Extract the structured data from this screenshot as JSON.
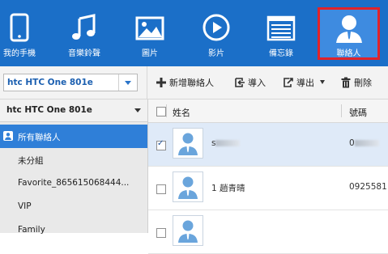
{
  "nav": {
    "items": [
      {
        "label": "我的手機",
        "icon": "phone-icon"
      },
      {
        "label": "音樂鈴聲",
        "icon": "music-note-icon"
      },
      {
        "label": "圖片",
        "icon": "picture-icon"
      },
      {
        "label": "影片",
        "icon": "video-play-icon"
      },
      {
        "label": "備忘錄",
        "icon": "memo-icon"
      },
      {
        "label": "聯絡人",
        "icon": "contact-person-icon",
        "active": true
      }
    ]
  },
  "device": {
    "selected": "htc HTC One 801e"
  },
  "toolbar": {
    "add": "新增聯絡人",
    "import": "導入",
    "export": "導出",
    "delete": "刪除"
  },
  "sidebar": {
    "header": "htc HTC One 801e",
    "items": [
      {
        "label": "所有聯絡人",
        "selected": true
      },
      {
        "label": "未分組"
      },
      {
        "label": "Favorite_865615068444..."
      },
      {
        "label": "VIP"
      },
      {
        "label": "Family"
      }
    ]
  },
  "list": {
    "col_name": "姓名",
    "col_phone": "號碼",
    "rows": [
      {
        "name": "s",
        "phone": "0",
        "checked": true
      },
      {
        "name": "1 趙青晴",
        "phone": "0925581",
        "checked": false
      },
      {
        "name": "",
        "phone": "",
        "checked": false
      }
    ]
  },
  "colors": {
    "topbar": "#1b6fc8",
    "active_border": "#e0232a",
    "selection": "#2f7fd8"
  }
}
